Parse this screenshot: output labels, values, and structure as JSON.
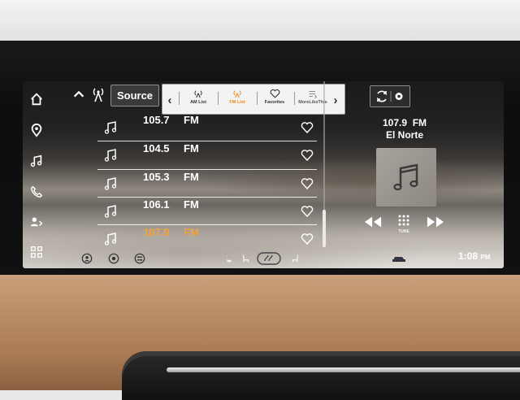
{
  "colors": {
    "accent": "#e98a1d",
    "active_text": "#f0a23d",
    "text": "#ffffff",
    "tabbar_bg": "#f3f3f3"
  },
  "sidebar": {
    "items": [
      {
        "icon": "home-icon"
      },
      {
        "icon": "location-pin-icon"
      },
      {
        "icon": "music-note-icon"
      },
      {
        "icon": "phone-icon"
      },
      {
        "icon": "connected-device-icon"
      },
      {
        "icon": "apps-grid-icon"
      }
    ]
  },
  "topbar": {
    "source_label": "Source",
    "tabs": [
      {
        "label": "AM List",
        "icon": "am-antenna-icon",
        "active": false
      },
      {
        "label": "FM List",
        "icon": "fm-antenna-icon",
        "active": true
      },
      {
        "label": "Favorites",
        "icon": "heart-icon",
        "active": false
      },
      {
        "label": "MoreLikeThis",
        "icon": "more-like-this-icon",
        "active": false
      }
    ]
  },
  "stations": [
    {
      "freq": "105.7",
      "band": "FM",
      "active": false
    },
    {
      "freq": "104.5",
      "band": "FM",
      "active": false
    },
    {
      "freq": "105.3",
      "band": "FM",
      "active": false
    },
    {
      "freq": "106.1",
      "band": "FM",
      "active": false
    },
    {
      "freq": "107.9",
      "band": "FM",
      "active": true
    }
  ],
  "now_playing": {
    "frequency": "107.9",
    "band": "FM",
    "station_name": "El Norte",
    "tune_label": "TUNE"
  },
  "status": {
    "time": "1:08",
    "ampm": "PM"
  }
}
